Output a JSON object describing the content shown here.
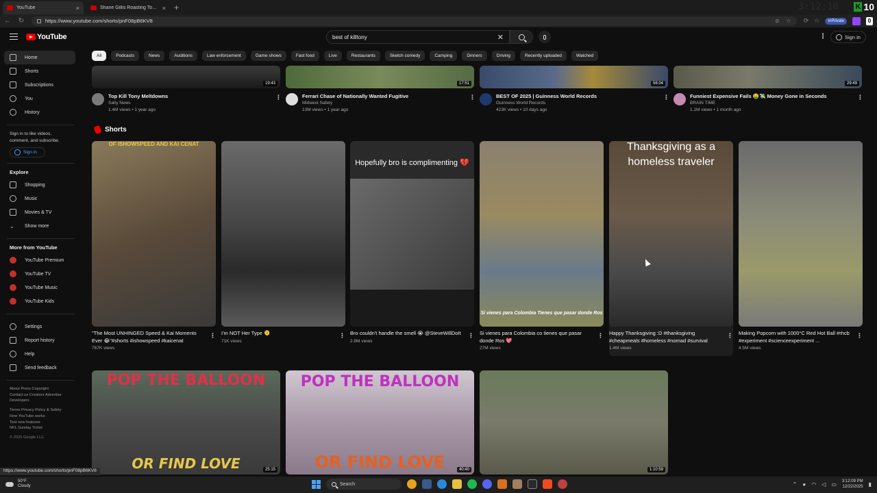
{
  "browser": {
    "tabs": [
      {
        "label": "YouTube",
        "active": true
      },
      {
        "label": "Shane Gillis Roasting Tony Hinchcliffe",
        "active": false
      }
    ],
    "url": "https://www.youtube.com/shorts/pnF08pB6KV8",
    "inprivate": "InPrivate",
    "kick_count": "10",
    "ghost_clock": "3:12:10"
  },
  "youtube": {
    "logo": "YouTube",
    "search_query": "best of killtony",
    "signin": "Sign in"
  },
  "sidebar": {
    "main": [
      {
        "label": "Home",
        "icon": "home-icon"
      },
      {
        "label": "Shorts",
        "icon": "shorts-icon"
      },
      {
        "label": "Subscriptions",
        "icon": "subscriptions-icon"
      },
      {
        "label": "You",
        "icon": "you-icon"
      },
      {
        "label": "History",
        "icon": "history-icon"
      }
    ],
    "signin_prompt": "Sign in to like videos, comment, and subscribe.",
    "signin_button": "Sign in",
    "explore_heading": "Explore",
    "explore": [
      {
        "label": "Shopping",
        "icon": "bag-icon"
      },
      {
        "label": "Music",
        "icon": "music-icon"
      },
      {
        "label": "Movies & TV",
        "icon": "film-icon"
      },
      {
        "label": "Show more",
        "icon": "chevron-down-icon"
      }
    ],
    "more_heading": "More from YouTube",
    "more": [
      {
        "label": "YouTube Premium"
      },
      {
        "label": "YouTube TV"
      },
      {
        "label": "YouTube Music"
      },
      {
        "label": "YouTube Kids"
      }
    ],
    "settings": [
      {
        "label": "Settings",
        "icon": "gear-icon"
      },
      {
        "label": "Report history",
        "icon": "flag-icon"
      },
      {
        "label": "Help",
        "icon": "help-icon"
      },
      {
        "label": "Send feedback",
        "icon": "feedback-icon"
      }
    ],
    "footer1": "About  Press  Copyright",
    "footer2": "Contact us  Creators  Advertise",
    "footer3": "Developers",
    "footer4": "Terms  Privacy  Policy & Safety",
    "footer5": "How YouTube works",
    "footer6": "Test new features",
    "footer7": "NFL Sunday Ticket",
    "copyright": "© 2025 Google LLC"
  },
  "chips": [
    "All",
    "Podcasts",
    "News",
    "Auditions",
    "Law enforcement",
    "Game shows",
    "Fast food",
    "Live",
    "Restaurants",
    "Sketch comedy",
    "Camping",
    "Dinners",
    "Driving",
    "Recently uploaded",
    "Watched"
  ],
  "videos": [
    {
      "title": "Top Kill Tony Meltdowns",
      "channel": "Salty News",
      "meta": "1.4M views • 1 year ago",
      "duration": "19:43"
    },
    {
      "title": "Ferrari Chase of Nationally Wanted Fugitive",
      "channel": "Midwest Safety",
      "meta": "13M views • 1 year ago",
      "duration": "17:51"
    },
    {
      "title": "BEST OF 2025 | Guinness World Records",
      "channel": "Guinness World Records",
      "meta": "423K views • 10 days ago",
      "duration": "56:04"
    },
    {
      "title": "Funniest Expensive Fails 🤑💸 Money Gone in Seconds",
      "channel": "BRAIN TIME",
      "meta": "1.1M views • 1 month ago",
      "duration": "29:49"
    }
  ],
  "shorts_heading": "Shorts",
  "shorts": [
    {
      "title": "\"The Most UNHINGED Speed & Kai Moments Ever 😂\"#shorts #ishowspeed #kaicenat",
      "views": "767K views",
      "overlay": "OF ISHOWSPEED AND KAI CENAT"
    },
    {
      "title": "I'm NOT Her Type 🫠",
      "views": "71K views",
      "overlay": ""
    },
    {
      "title": "Bro couldn't handle the smell 😭 @SteveWillDoIt",
      "views": "2.9M views",
      "overlay": "Hopefully bro is complimenting 💔"
    },
    {
      "title": "Si vienes para Colombia co tienes que pasar donde Ros 💖",
      "views": "27M views",
      "overlay": "Si vienes para Colombia Tienes que pasar donde Ros"
    },
    {
      "title": "Happy Thanksgiving :D #thanksgiving #cheapmeals #homeless #nomad #survival",
      "views": "1.4M views",
      "overlay": "Thanksgiving as a homeless traveler"
    },
    {
      "title": "Making Popcorn with 1000°C Red Hot Ball #rhcb #experiment #scienceexperiment ...",
      "views": "4.5M views",
      "overlay": ""
    }
  ],
  "bottom_videos": [
    {
      "top": "POP THE BALLOON",
      "bottom": "OR FIND LOVE",
      "duration": "25:15"
    },
    {
      "top": "POP THE BALLOON",
      "bottom": "OR FIND LOVE",
      "duration": "40:40"
    },
    {
      "top": "",
      "bottom": "",
      "duration": "1:10:59"
    }
  ],
  "status_url": "https://www.youtube.com/shorts/pnF08pB6KV8",
  "taskbar": {
    "temp": "50°F",
    "weather": "Cloudy",
    "search": "Search",
    "time": "3:12:09 PM",
    "date": "12/22/2025"
  }
}
